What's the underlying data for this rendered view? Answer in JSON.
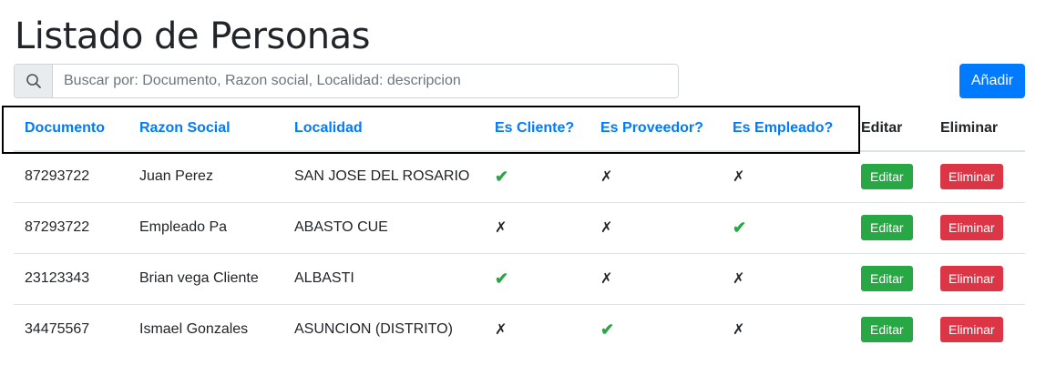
{
  "page": {
    "title": "Listado de Personas"
  },
  "search": {
    "placeholder": "Buscar por: Documento, Razon social, Localidad: descripcion",
    "value": ""
  },
  "toolbar": {
    "add_label": "Añadir"
  },
  "table": {
    "headers": [
      "Documento",
      "Razon Social",
      "Localidad",
      "Es Cliente?",
      "Es Proveedor?",
      "Es Empleado?",
      "Editar",
      "Eliminar"
    ],
    "rows": [
      {
        "documento": "87293722",
        "razon_social": "Juan Perez",
        "localidad": "SAN JOSE DEL ROSARIO",
        "cliente": "✔",
        "proveedor": "✗",
        "empleado": "✗",
        "edit_label": "Editar",
        "delete_label": "Eliminar"
      },
      {
        "documento": "87293722",
        "razon_social": "Empleado Pa",
        "localidad": "ABASTO CUE",
        "cliente": "✗",
        "proveedor": "✗",
        "empleado": "✔",
        "edit_label": "Editar",
        "delete_label": "Eliminar"
      },
      {
        "documento": "23123343",
        "razon_social": "Brian vega Cliente",
        "localidad": "ALBASTI",
        "cliente": "✔",
        "proveedor": "✗",
        "empleado": "✗",
        "edit_label": "Editar",
        "delete_label": "Eliminar"
      },
      {
        "documento": "34475567",
        "razon_social": "Ismael Gonzales",
        "localidad": "ASUNCION (DISTRITO)",
        "cliente": "✗",
        "proveedor": "✔",
        "empleado": "✗",
        "edit_label": "Editar",
        "delete_label": "Eliminar"
      }
    ]
  },
  "icons": {
    "search": "search-icon",
    "check": "check-icon",
    "cross": "cross-icon"
  },
  "colors": {
    "primary": "#007bff",
    "success": "#28a745",
    "danger": "#dc3545",
    "check": "#28a745"
  }
}
